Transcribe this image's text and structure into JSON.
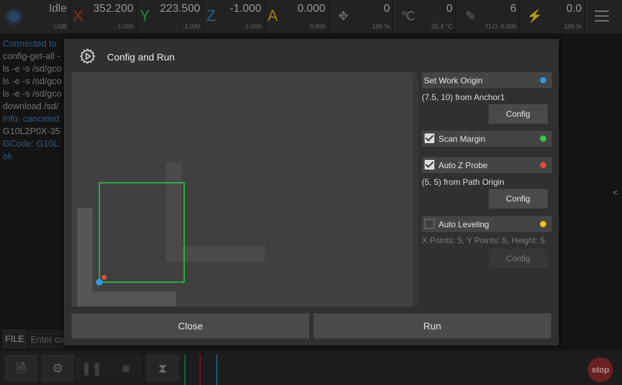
{
  "status": {
    "state": "Idle",
    "conn": "USB"
  },
  "axes": [
    {
      "letter": "X",
      "value": "352.200",
      "sub": "-1.000",
      "color": "#c0392b"
    },
    {
      "letter": "Y",
      "value": "223.500",
      "sub": "-1.000",
      "color": "#27ae60"
    },
    {
      "letter": "Z",
      "value": "-1.000",
      "sub": "-1.000",
      "color": "#2e86c1"
    },
    {
      "letter": "A",
      "value": "0.000",
      "sub": "0.000",
      "color": "#d4ac0d"
    }
  ],
  "indicators": [
    {
      "icon": "move-icon",
      "glyph": "✥",
      "value": "0",
      "sub": "100 %"
    },
    {
      "icon": "temperature-icon",
      "glyph": "℃",
      "value": "0",
      "sub": "25.4 °C"
    },
    {
      "icon": "tool-icon",
      "glyph": "✎",
      "value": "6",
      "sub": "TLO: 0.000"
    },
    {
      "icon": "laser-icon",
      "glyph": "⚡",
      "value": "0.0",
      "sub": "100 %"
    }
  ],
  "console": {
    "lines": [
      {
        "text": "Connected to",
        "tone": "blue"
      },
      {
        "text": "config-get-all -",
        "tone": "gray"
      },
      {
        "text": "ls -e -s /sd/gco",
        "tone": "gray"
      },
      {
        "text": "ls -e -s /sd/gco",
        "tone": "gray"
      },
      {
        "text": "ls -e -s /sd/gco",
        "tone": "gray"
      },
      {
        "text": "download /sd/",
        "tone": "gray"
      },
      {
        "text": "Info: canceled",
        "tone": "blue"
      },
      {
        "text": "G10L2P0X-35",
        "tone": "gray"
      },
      {
        "text": "GCode: G10L",
        "tone": "blue"
      },
      {
        "text": "ok",
        "tone": "blue"
      }
    ]
  },
  "filebar": {
    "label": "FILE",
    "placeholder": "Enter co"
  },
  "side_arrow": "<",
  "stop_label": "stop",
  "dialog": {
    "title": "Config and Run",
    "options": [
      {
        "label": "Set Work Origin",
        "checkbox": false,
        "checked": false,
        "color": "#3498db",
        "desc": "(7.5, 10) from Anchor1",
        "button": "Config",
        "enabled": true
      },
      {
        "label": "Scan Margin",
        "checkbox": true,
        "checked": true,
        "color": "#2ecc40",
        "desc": "",
        "button": "",
        "enabled": true
      },
      {
        "label": "Auto Z Probe",
        "checkbox": true,
        "checked": true,
        "color": "#e74c3c",
        "desc": "(5, 5) from Path Origin",
        "button": "Config",
        "enabled": true
      },
      {
        "label": "Auto Leveling",
        "checkbox": true,
        "checked": false,
        "color": "#f1c40f",
        "desc": "X Points: 5, Y Points: 5, Height: 5",
        "button": "Config",
        "enabled": false
      }
    ],
    "close_label": "Close",
    "run_label": "Run",
    "preview": {
      "margin_color": "#2ecc40",
      "origin_color": "#3498db",
      "probe_color": "#e74c3c"
    }
  }
}
